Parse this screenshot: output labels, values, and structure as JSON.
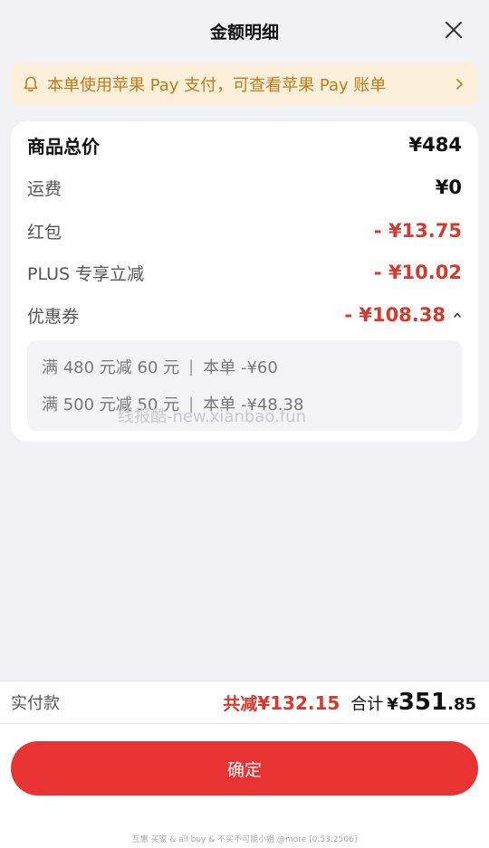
{
  "header": {
    "title": "金额明细"
  },
  "notice": {
    "text": "本单使用苹果 Pay 支付，可查看苹果 Pay 账单"
  },
  "breakdown": {
    "total": {
      "label": "商品总价",
      "value": "¥484"
    },
    "shipping": {
      "label": "运费",
      "value": "¥0"
    },
    "red_packet": {
      "label": "红包",
      "value": "- ¥13.75"
    },
    "plus": {
      "label": "PLUS 专享立减",
      "value": "- ¥10.02"
    },
    "coupon": {
      "label": "优惠券",
      "value": "- ¥108.38"
    }
  },
  "coupons": [
    {
      "rule": "满 480 元减 60 元",
      "sep": "|",
      "detail": "本单 -¥60"
    },
    {
      "rule": "满 500 元减 50 元",
      "sep": "|",
      "detail": "本单 -¥48.38"
    }
  ],
  "watermark": "线报酷-new.xianbao.fun",
  "pay_bar": {
    "label": "实付款",
    "saved_label": "共减",
    "saved_amount": "¥132.15",
    "sum_label": "合计",
    "sum_currency": "¥",
    "sum_int": "351",
    "sum_dec": ".85"
  },
  "confirm_label": "确定",
  "footer_note": "互惠 买家 & all buy & 不买不可能小姐 @more [0:53:2506]",
  "colors": {
    "accent": "#e93232",
    "discount": "#d9382c",
    "notice_bg": "#fdf0da",
    "notice_text": "#c07a1a"
  }
}
